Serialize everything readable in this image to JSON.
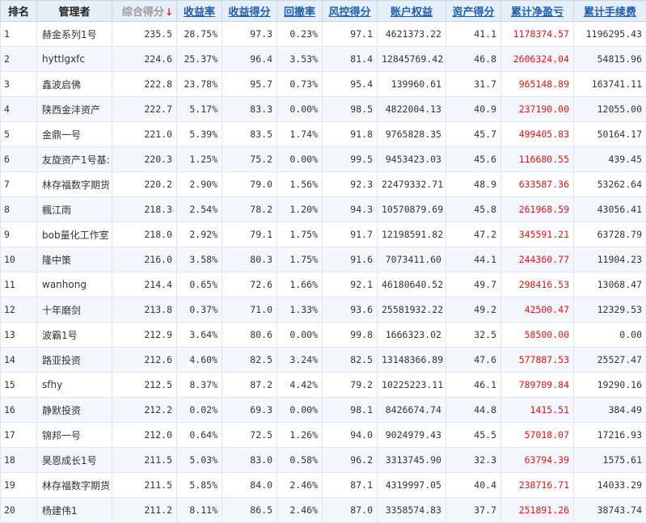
{
  "table": {
    "headers": {
      "rank": "排名",
      "manager": "管理者",
      "total_score": "综合得分",
      "return_rate": "收益率",
      "return_score": "收益得分",
      "drawdown": "回撤率",
      "risk_score": "风控得分",
      "equity": "账户权益",
      "asset_score": "资产得分",
      "cum_net_pnl": "累计净盈亏",
      "cum_fees": "累计手续费"
    },
    "sort_indicator": "↓",
    "rows": [
      {
        "rank": "1",
        "manager": "赫金系列1号",
        "total_score": "235.5",
        "return_rate": "28.75%",
        "return_score": "97.3",
        "drawdown": "0.23%",
        "risk_score": "97.1",
        "equity": "4621373.22",
        "asset_score": "41.1",
        "cum_net_pnl": "1178374.57",
        "cum_fees": "1196295.43"
      },
      {
        "rank": "2",
        "manager": "hyttlgxfc",
        "total_score": "224.6",
        "return_rate": "25.37%",
        "return_score": "96.4",
        "drawdown": "3.53%",
        "risk_score": "81.4",
        "equity": "12845769.42",
        "asset_score": "46.8",
        "cum_net_pnl": "2606324.04",
        "cum_fees": "54815.96"
      },
      {
        "rank": "3",
        "manager": "鑫波启佛",
        "total_score": "222.8",
        "return_rate": "23.78%",
        "return_score": "95.7",
        "drawdown": "0.73%",
        "risk_score": "95.4",
        "equity": "139960.61",
        "asset_score": "31.7",
        "cum_net_pnl": "965148.89",
        "cum_fees": "163741.11"
      },
      {
        "rank": "4",
        "manager": "陕西金沣资产",
        "total_score": "222.7",
        "return_rate": "5.17%",
        "return_score": "83.3",
        "drawdown": "0.00%",
        "risk_score": "98.5",
        "equity": "4822004.13",
        "asset_score": "40.9",
        "cum_net_pnl": "237190.00",
        "cum_fees": "12055.00"
      },
      {
        "rank": "5",
        "manager": "金鼎一号",
        "total_score": "221.0",
        "return_rate": "5.39%",
        "return_score": "83.5",
        "drawdown": "1.74%",
        "risk_score": "91.8",
        "equity": "9765828.35",
        "asset_score": "45.7",
        "cum_net_pnl": "499405.83",
        "cum_fees": "50164.17"
      },
      {
        "rank": "6",
        "manager": "友旋资产1号基:",
        "total_score": "220.3",
        "return_rate": "1.25%",
        "return_score": "75.2",
        "drawdown": "0.00%",
        "risk_score": "99.5",
        "equity": "9453423.03",
        "asset_score": "45.6",
        "cum_net_pnl": "116680.55",
        "cum_fees": "439.45"
      },
      {
        "rank": "7",
        "manager": "林存福数字期货",
        "total_score": "220.2",
        "return_rate": "2.90%",
        "return_score": "79.0",
        "drawdown": "1.56%",
        "risk_score": "92.3",
        "equity": "22479332.71",
        "asset_score": "48.9",
        "cum_net_pnl": "633587.36",
        "cum_fees": "53262.64"
      },
      {
        "rank": "8",
        "manager": "楓江雨",
        "total_score": "218.3",
        "return_rate": "2.54%",
        "return_score": "78.2",
        "drawdown": "1.20%",
        "risk_score": "94.3",
        "equity": "10570879.69",
        "asset_score": "45.8",
        "cum_net_pnl": "261968.59",
        "cum_fees": "43056.41"
      },
      {
        "rank": "9",
        "manager": "bob量化工作室",
        "total_score": "218.0",
        "return_rate": "2.92%",
        "return_score": "79.1",
        "drawdown": "1.75%",
        "risk_score": "91.7",
        "equity": "12198591.82",
        "asset_score": "47.2",
        "cum_net_pnl": "345591.21",
        "cum_fees": "63728.79"
      },
      {
        "rank": "10",
        "manager": "隆中策",
        "total_score": "216.0",
        "return_rate": "3.58%",
        "return_score": "80.3",
        "drawdown": "1.75%",
        "risk_score": "91.6",
        "equity": "7073411.60",
        "asset_score": "44.1",
        "cum_net_pnl": "244360.77",
        "cum_fees": "11904.23"
      },
      {
        "rank": "11",
        "manager": "wanhong",
        "total_score": "214.4",
        "return_rate": "0.65%",
        "return_score": "72.6",
        "drawdown": "1.66%",
        "risk_score": "92.1",
        "equity": "46180640.52",
        "asset_score": "49.7",
        "cum_net_pnl": "298416.53",
        "cum_fees": "13068.47"
      },
      {
        "rank": "12",
        "manager": "十年磨剑",
        "total_score": "213.8",
        "return_rate": "0.37%",
        "return_score": "71.0",
        "drawdown": "1.33%",
        "risk_score": "93.6",
        "equity": "25581932.22",
        "asset_score": "49.2",
        "cum_net_pnl": "42500.47",
        "cum_fees": "12329.53"
      },
      {
        "rank": "13",
        "manager": "波霸1号",
        "total_score": "212.9",
        "return_rate": "3.64%",
        "return_score": "80.6",
        "drawdown": "0.00%",
        "risk_score": "99.8",
        "equity": "1666323.02",
        "asset_score": "32.5",
        "cum_net_pnl": "58500.00",
        "cum_fees": "0.00"
      },
      {
        "rank": "14",
        "manager": "路亚投资",
        "total_score": "212.6",
        "return_rate": "4.60%",
        "return_score": "82.5",
        "drawdown": "3.24%",
        "risk_score": "82.5",
        "equity": "13148366.89",
        "asset_score": "47.6",
        "cum_net_pnl": "577887.53",
        "cum_fees": "25527.47"
      },
      {
        "rank": "15",
        "manager": "sfhy",
        "total_score": "212.5",
        "return_rate": "8.37%",
        "return_score": "87.2",
        "drawdown": "4.42%",
        "risk_score": "79.2",
        "equity": "10225223.11",
        "asset_score": "46.1",
        "cum_net_pnl": "789709.84",
        "cum_fees": "19290.16"
      },
      {
        "rank": "16",
        "manager": "静默投资",
        "total_score": "212.2",
        "return_rate": "0.02%",
        "return_score": "69.3",
        "drawdown": "0.00%",
        "risk_score": "98.1",
        "equity": "8426674.74",
        "asset_score": "44.8",
        "cum_net_pnl": "1415.51",
        "cum_fees": "384.49"
      },
      {
        "rank": "17",
        "manager": "锦邦一号",
        "total_score": "212.0",
        "return_rate": "0.64%",
        "return_score": "72.5",
        "drawdown": "1.26%",
        "risk_score": "94.0",
        "equity": "9024979.43",
        "asset_score": "45.5",
        "cum_net_pnl": "57018.07",
        "cum_fees": "17216.93"
      },
      {
        "rank": "18",
        "manager": "昊恩成长1号",
        "total_score": "211.5",
        "return_rate": "5.03%",
        "return_score": "83.0",
        "drawdown": "0.58%",
        "risk_score": "96.2",
        "equity": "3313745.90",
        "asset_score": "32.3",
        "cum_net_pnl": "63794.39",
        "cum_fees": "1575.61"
      },
      {
        "rank": "19",
        "manager": "林存福数字期货",
        "total_score": "211.5",
        "return_rate": "5.85%",
        "return_score": "84.0",
        "drawdown": "2.46%",
        "risk_score": "87.1",
        "equity": "4319997.05",
        "asset_score": "40.4",
        "cum_net_pnl": "238716.71",
        "cum_fees": "14033.29"
      },
      {
        "rank": "20",
        "manager": "杨建伟1",
        "total_score": "211.2",
        "return_rate": "8.11%",
        "return_score": "86.5",
        "drawdown": "2.46%",
        "risk_score": "87.0",
        "equity": "3358574.83",
        "asset_score": "37.7",
        "cum_net_pnl": "251891.26",
        "cum_fees": "38743.74"
      }
    ]
  }
}
